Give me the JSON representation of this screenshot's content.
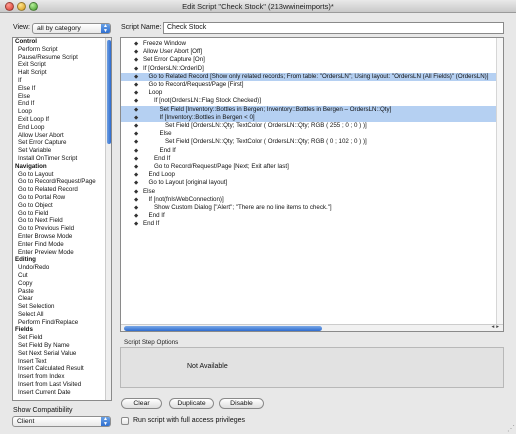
{
  "window": {
    "title": "Edit Script \"Check Stock\" (213wwineimports)*"
  },
  "view": {
    "label": "View:",
    "value": "all by category"
  },
  "script_name": {
    "label": "Script Name:",
    "value": "Check Stock"
  },
  "steps_list": [
    {
      "text": "Control",
      "header": true
    },
    {
      "text": "Perform Script"
    },
    {
      "text": "Pause/Resume Script"
    },
    {
      "text": "Exit Script"
    },
    {
      "text": "Halt Script"
    },
    {
      "text": "If"
    },
    {
      "text": "Else If"
    },
    {
      "text": "Else"
    },
    {
      "text": "End If"
    },
    {
      "text": "Loop"
    },
    {
      "text": "Exit Loop If"
    },
    {
      "text": "End Loop"
    },
    {
      "text": "Allow User Abort"
    },
    {
      "text": "Set Error Capture"
    },
    {
      "text": "Set Variable"
    },
    {
      "text": "Install OnTimer Script"
    },
    {
      "text": "Navigation",
      "header": true
    },
    {
      "text": "Go to Layout"
    },
    {
      "text": "Go to Record/Request/Page"
    },
    {
      "text": "Go to Related Record"
    },
    {
      "text": "Go to Portal Row"
    },
    {
      "text": "Go to Object"
    },
    {
      "text": "Go to Field"
    },
    {
      "text": "Go to Next Field"
    },
    {
      "text": "Go to Previous Field"
    },
    {
      "text": "Enter Browse Mode"
    },
    {
      "text": "Enter Find Mode"
    },
    {
      "text": "Enter Preview Mode"
    },
    {
      "text": "Editing",
      "header": true
    },
    {
      "text": "Undo/Redo"
    },
    {
      "text": "Cut"
    },
    {
      "text": "Copy"
    },
    {
      "text": "Paste"
    },
    {
      "text": "Clear"
    },
    {
      "text": "Set Selection"
    },
    {
      "text": "Select All"
    },
    {
      "text": "Perform Find/Replace"
    },
    {
      "text": "Fields",
      "header": true
    },
    {
      "text": "Set Field"
    },
    {
      "text": "Set Field By Name"
    },
    {
      "text": "Set Next Serial Value"
    },
    {
      "text": "Insert Text"
    },
    {
      "text": "Insert Calculated Result"
    },
    {
      "text": "Insert from Index"
    },
    {
      "text": "Insert from Last Visited"
    },
    {
      "text": "Insert Current Date"
    }
  ],
  "script_steps": [
    {
      "indent": 0,
      "text": "Freeze Window"
    },
    {
      "indent": 0,
      "text": "Allow User Abort [Off]"
    },
    {
      "indent": 0,
      "text": "Set Error Capture [On]"
    },
    {
      "indent": 0,
      "text": "If [OrdersLN::OrderID]"
    },
    {
      "indent": 1,
      "text": "Go to Related Record [Show only related records; From table: \"OrdersLN\"; Using layout: \"OrdersLN (All Fields)\" (OrdersLN)]",
      "selected": true
    },
    {
      "indent": 1,
      "text": "Go to Record/Request/Page [First]"
    },
    {
      "indent": 1,
      "text": "Loop"
    },
    {
      "indent": 2,
      "text": "If [not(OrdersLN::Flag Stock Checked)]"
    },
    {
      "indent": 3,
      "text": "Set Field [Inventory::Bottles in Bergen; Inventory::Bottles in Bergen – OrdersLN::Qty]",
      "selected": true
    },
    {
      "indent": 3,
      "text": "If [Inventory::Bottles in Bergen < 0]",
      "selected": true
    },
    {
      "indent": 4,
      "text": "Set Field [OrdersLN::Qty; TextColor ( OrdersLN::Qty; RGB ( 255 ; 0 ; 0 ) )]"
    },
    {
      "indent": 3,
      "text": "Else"
    },
    {
      "indent": 4,
      "text": "Set Field [OrdersLN::Qty; TextColor ( OrdersLN::Qty; RGB ( 0 ; 102 ; 0 ) )]"
    },
    {
      "indent": 3,
      "text": "End If"
    },
    {
      "indent": 2,
      "text": "End If"
    },
    {
      "indent": 2,
      "text": "Go to Record/Request/Page [Next; Exit after last]"
    },
    {
      "indent": 1,
      "text": "End Loop"
    },
    {
      "indent": 1,
      "text": "Go to Layout [original layout]"
    },
    {
      "indent": 0,
      "text": "Else"
    },
    {
      "indent": 1,
      "text": "If [not(fnIsWebConnection)]"
    },
    {
      "indent": 2,
      "text": "Show Custom Dialog [\"Alert\"; \"There are no line items to check.\"]"
    },
    {
      "indent": 1,
      "text": "End If"
    },
    {
      "indent": 0,
      "text": "End If"
    }
  ],
  "options": {
    "label": "Script Step Options",
    "text": "Not Available"
  },
  "buttons": {
    "clear": "Clear",
    "duplicate": "Duplicate",
    "disable": "Disable"
  },
  "compat": {
    "label": "Show Compatibility",
    "value": "Client"
  },
  "full_access": {
    "label": "Run script with full access privileges",
    "checked": false
  },
  "colors": {
    "selection": "#b5d0f2",
    "accent": "#2e6cd0"
  }
}
